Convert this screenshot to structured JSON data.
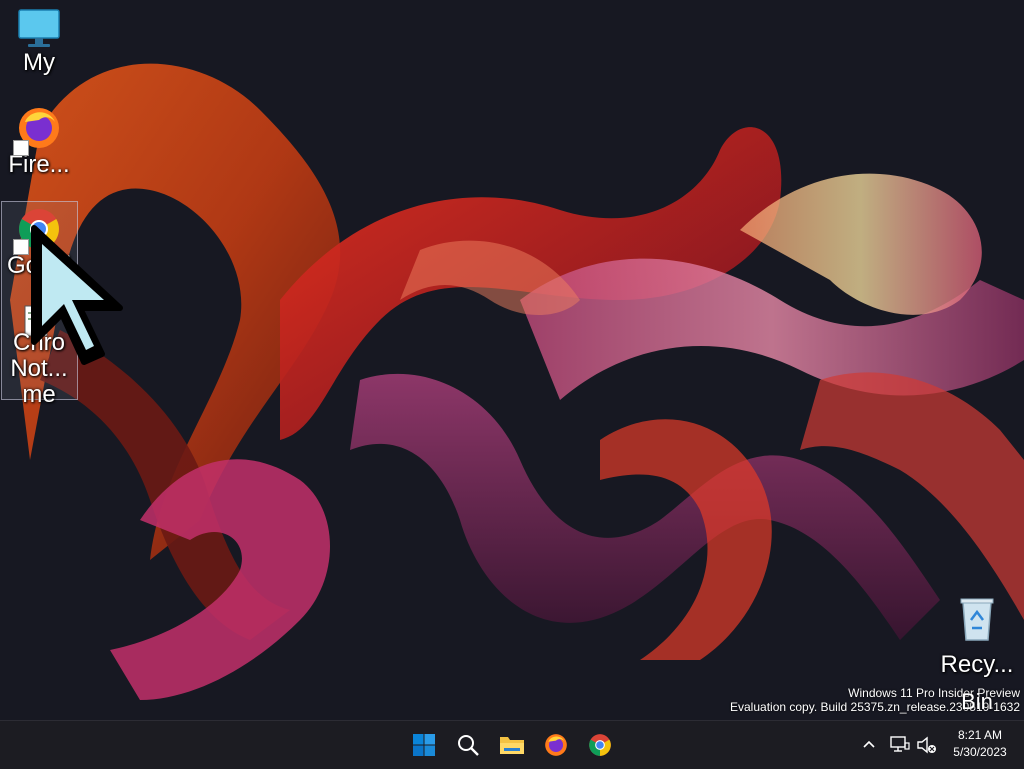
{
  "desktop": {
    "icons": [
      {
        "label": "My",
        "icon": "computer-icon"
      },
      {
        "label": "Fire...",
        "icon": "firefox-icon"
      },
      {
        "label": "Googl",
        "icon": "chrome-icon"
      },
      {
        "label": "Chro",
        "icon": "chrome-icon"
      },
      {
        "label": "Not...",
        "icon": "notepad-icon"
      },
      {
        "label": "me",
        "icon": "chrome-icon"
      }
    ],
    "recycle_bin": {
      "label_line1": "Recy...",
      "label_line2": "Bin",
      "icon": "recycle-bin-icon"
    }
  },
  "watermark": {
    "line1": "Windows 11 Pro Insider Preview",
    "line2": "Evaluation copy. Build 25375.zn_release.230519-1632"
  },
  "taskbar": {
    "pinned": [
      {
        "name": "Start",
        "icon": "windows-logo-icon"
      },
      {
        "name": "Search",
        "icon": "search-icon"
      },
      {
        "name": "File Explorer",
        "icon": "folder-icon"
      },
      {
        "name": "Firefox",
        "icon": "firefox-icon"
      },
      {
        "name": "Chrome",
        "icon": "chrome-icon"
      }
    ],
    "tray": {
      "chevron_icon": "chevron-up-icon",
      "network_icon": "network-icon",
      "volume_icon": "volume-muted-icon",
      "time": "8:21 AM",
      "date": "5/30/2023"
    }
  },
  "colors": {
    "taskbar_bg": "#1c1c22",
    "desktop_bg": "#171822",
    "windows_blue": "#0a84d8",
    "folder_yellow": "#f4c243"
  }
}
